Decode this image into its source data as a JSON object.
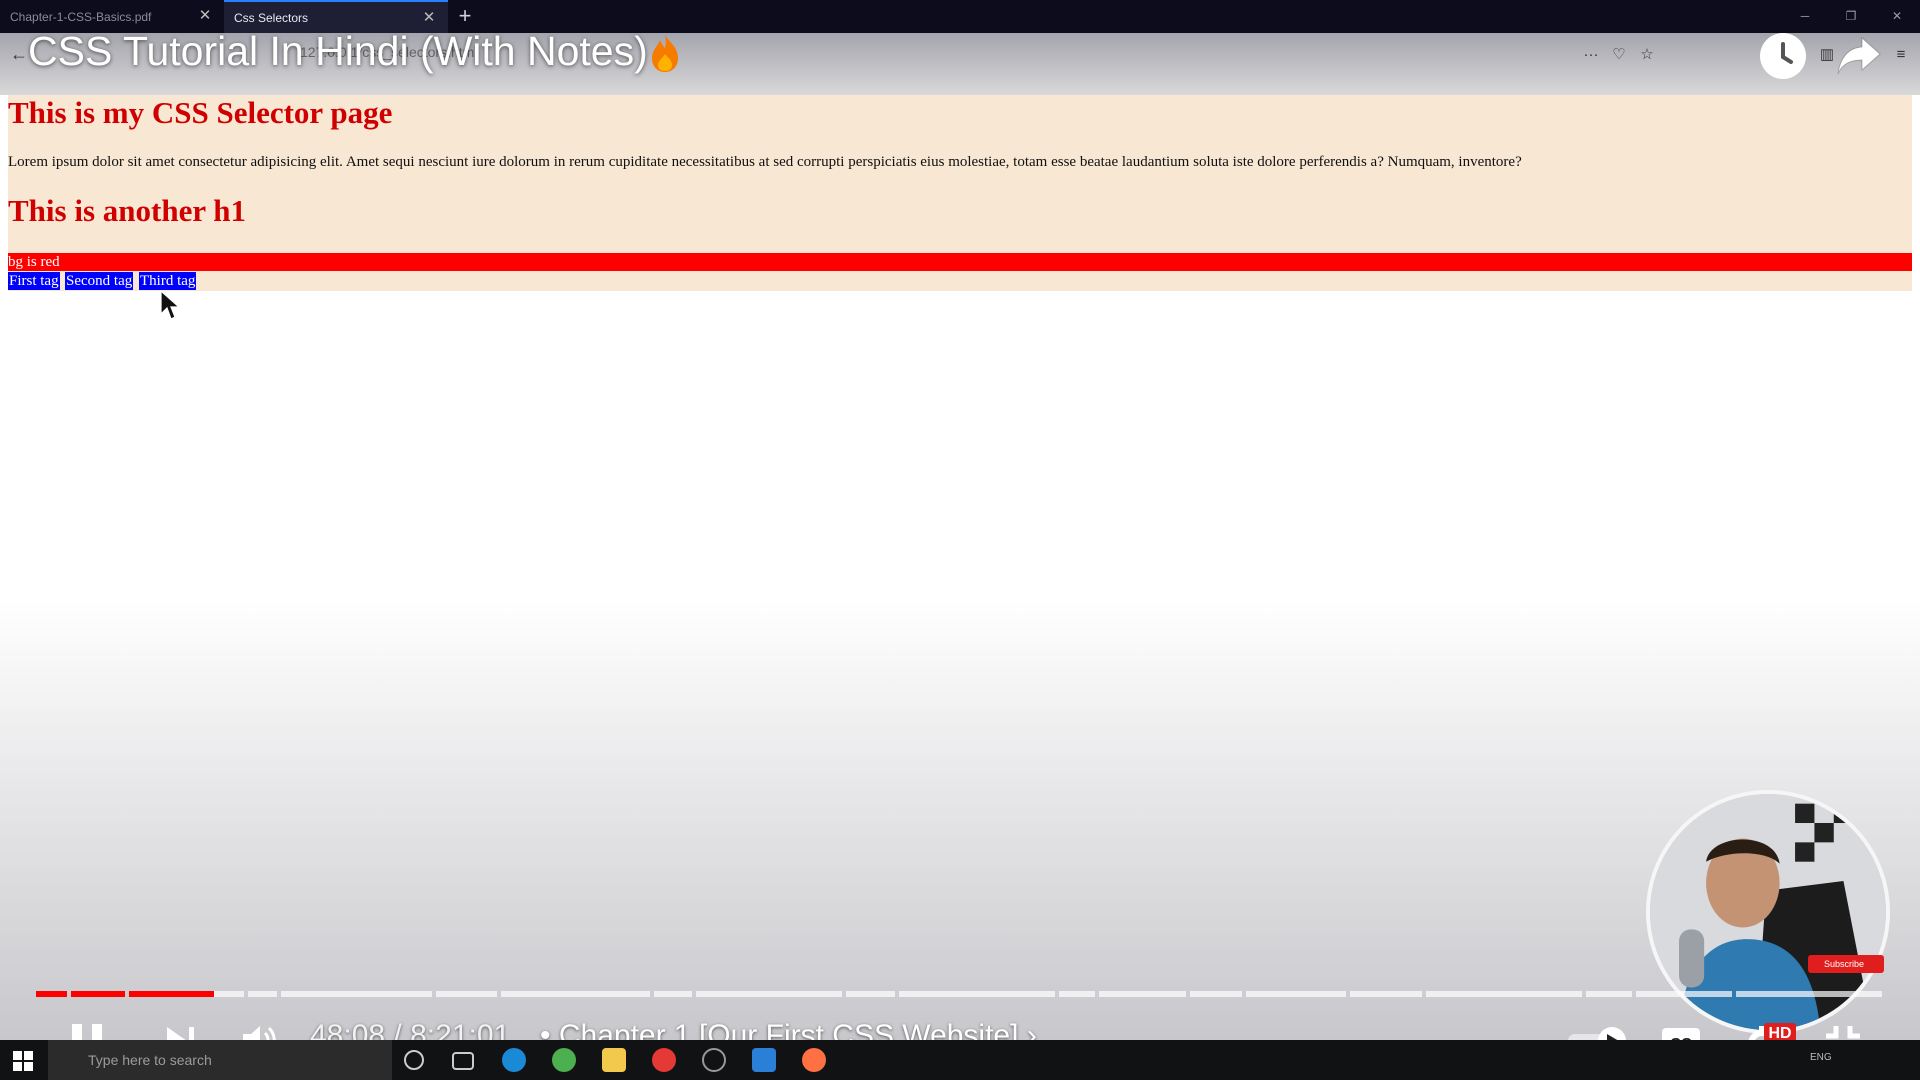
{
  "browser": {
    "tabs": [
      {
        "label": "Chapter-1-CSS-Basics.pdf",
        "active": false
      },
      {
        "label": "Css Selectors",
        "active": true
      }
    ],
    "url": "127.0.0.1/css_selectors.html",
    "new_tab_symbol": "+",
    "close_symbol": "✕",
    "window_controls": {
      "minimize": "─",
      "maximize": "❐",
      "close": "✕"
    }
  },
  "video": {
    "title": "CSS Tutorial In Hindi (With Notes)",
    "current_time": "48:08",
    "time_separator": "/",
    "duration": "8:21:01",
    "chapter_separator": "•",
    "chapter": "Chapter 1 [Our First CSS Website]",
    "chapter_chevron": "›",
    "quality_badge": "HD",
    "played_fraction": 0.096,
    "subscribe_label": "Subscribe",
    "autoplay_on": true
  },
  "webpage": {
    "heading_1": "This is my CSS Selector page",
    "paragraph": "Lorem ipsum dolor sit amet consectetur adipisicing elit. Amet sequi nesciunt iure dolorum in rerum cupiditate necessitatibus at sed corrupti perspiciatis eius molestiae, totam esse beatae laudantium soluta iste dolore perferendis a? Numquam, inventore?",
    "heading_2": "This is another h1",
    "red_div": "bg is red",
    "tags": [
      "First tag",
      "Second tag",
      "Third tag"
    ]
  },
  "taskbar": {
    "search_placeholder": "Type here to search",
    "language": "ENG"
  },
  "colors": {
    "page_background": "#f7e7d3",
    "heading_red": "#d10000",
    "bg_red": "#ff0000",
    "tag_blue": "#0000ff",
    "progress_red": "#ff0000"
  }
}
